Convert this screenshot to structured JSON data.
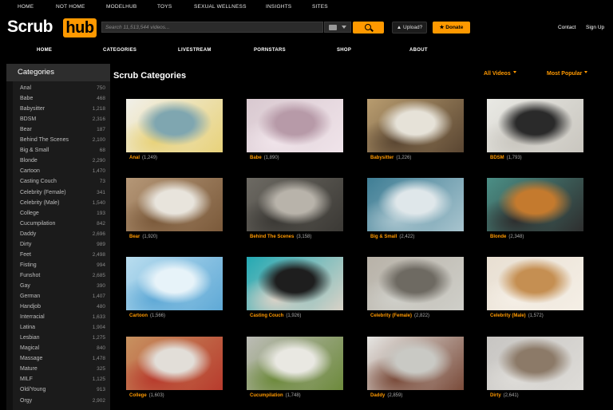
{
  "top_nav": [
    "HOME",
    "NOT HOME",
    "MODELHUB",
    "TOYS",
    "SEXUAL WELLNESS",
    "INSIGHTS",
    "SITES"
  ],
  "logo": {
    "part1": "Scrub",
    "part2": "hub",
    "accent": "#ff9900"
  },
  "search": {
    "placeholder": "Search 11,513,544 videos..."
  },
  "upload_label": "Upload?",
  "donate_label": "Donate",
  "links": {
    "contact": "Contact",
    "signup": "Sign Up"
  },
  "main_nav": [
    "HOME",
    "CATEGORIES",
    "LIVESTREAM",
    "PORNSTARS",
    "SHOP",
    "ABOUT"
  ],
  "sidebar": {
    "title": "Categories",
    "items": [
      {
        "label": "Anal",
        "count": "750"
      },
      {
        "label": "Babe",
        "count": "468"
      },
      {
        "label": "Babysitter",
        "count": "1,218"
      },
      {
        "label": "BDSM",
        "count": "2,316"
      },
      {
        "label": "Bear",
        "count": "187"
      },
      {
        "label": "Behind The Scenes",
        "count": "2,100"
      },
      {
        "label": "Big & Small",
        "count": "68"
      },
      {
        "label": "Blonde",
        "count": "2,290"
      },
      {
        "label": "Cartoon",
        "count": "1,470"
      },
      {
        "label": "Casting Couch",
        "count": "73"
      },
      {
        "label": "Celebrity (Female)",
        "count": "341"
      },
      {
        "label": "Celebrity (Male)",
        "count": "1,540"
      },
      {
        "label": "College",
        "count": "193"
      },
      {
        "label": "Cucumpilation",
        "count": "842"
      },
      {
        "label": "Daddy",
        "count": "2,696"
      },
      {
        "label": "Dirty",
        "count": "989"
      },
      {
        "label": "Feet",
        "count": "2,498"
      },
      {
        "label": "Fisting",
        "count": "994"
      },
      {
        "label": "Funshot",
        "count": "2,685"
      },
      {
        "label": "Gay",
        "count": "390"
      },
      {
        "label": "German",
        "count": "1,407"
      },
      {
        "label": "Handjob",
        "count": "480"
      },
      {
        "label": "Interracial",
        "count": "1,633"
      },
      {
        "label": "Latina",
        "count": "1,904"
      },
      {
        "label": "Lesbian",
        "count": "1,275"
      },
      {
        "label": "Magical",
        "count": "840"
      },
      {
        "label": "Massage",
        "count": "1,478"
      },
      {
        "label": "Mature",
        "count": "325"
      },
      {
        "label": "MILF",
        "count": "1,125"
      },
      {
        "label": "Old/Young",
        "count": "913"
      },
      {
        "label": "Orgy",
        "count": "2,902"
      }
    ]
  },
  "main": {
    "heading": "Scrub Categories",
    "filter_videos": "All Videos",
    "filter_sort": "Most Popular"
  },
  "tiles": [
    {
      "name": "Anal",
      "count": "(1,249)",
      "colors": [
        "#f1f0ea",
        "#7fa6b0",
        "#e8d27a"
      ]
    },
    {
      "name": "Babe",
      "count": "(1,890)",
      "colors": [
        "#d9c9d0",
        "#b79aa8",
        "#f0e4ea"
      ]
    },
    {
      "name": "Babysitter",
      "count": "(1,226)",
      "colors": [
        "#b89c6f",
        "#e6e2d8",
        "#5a4632"
      ]
    },
    {
      "name": "BDSM",
      "count": "(1,793)",
      "colors": [
        "#e9e9e4",
        "#2a2a2a",
        "#c9c6bf"
      ]
    },
    {
      "name": "Bear",
      "count": "(1,920)",
      "colors": [
        "#b59777",
        "#e8e4dc",
        "#7b5a3b"
      ]
    },
    {
      "name": "Behind The Scenes",
      "count": "(3,158)",
      "colors": [
        "#6d6a63",
        "#b8b3aa",
        "#3b3935"
      ]
    },
    {
      "name": "Big & Small",
      "count": "(2,422)",
      "colors": [
        "#3f7e95",
        "#dfe7ea",
        "#a8c4ce"
      ]
    },
    {
      "name": "Blonde",
      "count": "(2,348)",
      "colors": [
        "#4b8f86",
        "#c47a2e",
        "#2e2e2e"
      ]
    },
    {
      "name": "Cartoon",
      "count": "(1,566)",
      "colors": [
        "#b9ddef",
        "#e7f3f9",
        "#5fa9d6"
      ]
    },
    {
      "name": "Casting Couch",
      "count": "(1,926)",
      "colors": [
        "#23a9b3",
        "#1e1e1e",
        "#d9d2c7"
      ]
    },
    {
      "name": "Celebrity (Female)",
      "count": "(2,822)",
      "colors": [
        "#b8b2a8",
        "#6e6a62",
        "#cfcfc9"
      ]
    },
    {
      "name": "Celebrity (Male)",
      "count": "(1,572)",
      "colors": [
        "#e8dfd2",
        "#c58f52",
        "#f5efe6"
      ]
    },
    {
      "name": "College",
      "count": "(1,603)",
      "colors": [
        "#c79260",
        "#e2ded8",
        "#b83b2d"
      ]
    },
    {
      "name": "Cucumpilation",
      "count": "(1,748)",
      "colors": [
        "#bcbcb6",
        "#e9e8e2",
        "#6d8a3c"
      ]
    },
    {
      "name": "Daddy",
      "count": "(2,859)",
      "colors": [
        "#e6e6e3",
        "#c9c9c4",
        "#7a4b3a"
      ]
    },
    {
      "name": "Dirty",
      "count": "(2,641)",
      "colors": [
        "#c7c5c2",
        "#8c7a68",
        "#dedcd8"
      ]
    }
  ]
}
